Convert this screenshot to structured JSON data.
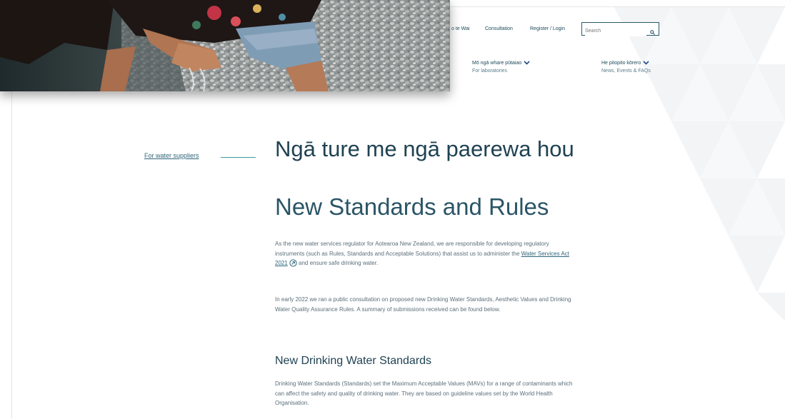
{
  "utility_nav": {
    "item1": "o te Wai",
    "item2": "Consultation",
    "item3": "Register / Login"
  },
  "search": {
    "placeholder": "Search"
  },
  "main_nav": [
    {
      "label": "Mō ngā whare pūtaiao",
      "sublabel": "For laboratories"
    },
    {
      "label": "He pitopito kōrero",
      "sublabel": "News, Events & FAQs"
    }
  ],
  "sidebar": {
    "link": "For water suppliers"
  },
  "page": {
    "title_maori": "Ngā ture me ngā paerewa hou",
    "title_english": "New Standards and Rules"
  },
  "content": {
    "p1_before": "As the new water services regulator for Aotearoa New Zealand, we are responsible for developing regulatory instruments (such as Rules, Standards and Acceptable Solutions) that assist us to administer the ",
    "p1_link": "Water Services Act 2021",
    "p1_after": " and ensure safe drinking water.",
    "p2": "In early 2022 we ran a public consultation on proposed new Drinking Water Standards, Aesthetic Values and Drinking Water Quality Assurance Rules. A summary of submissions received can be found below.",
    "h2": "New Drinking Water Standards",
    "p3": "Drinking Water Standards (Standards) set the Maximum Acceptable Values (MAVs) for a range of contaminants which can affect the safety and quality of drinking water. They are based on guideline values set by the World Health Organisation."
  },
  "colors": {
    "heading": "#1f4252",
    "link": "#2f6579",
    "accent_line": "#3a9aa8",
    "body_text": "#5b6f7a"
  }
}
